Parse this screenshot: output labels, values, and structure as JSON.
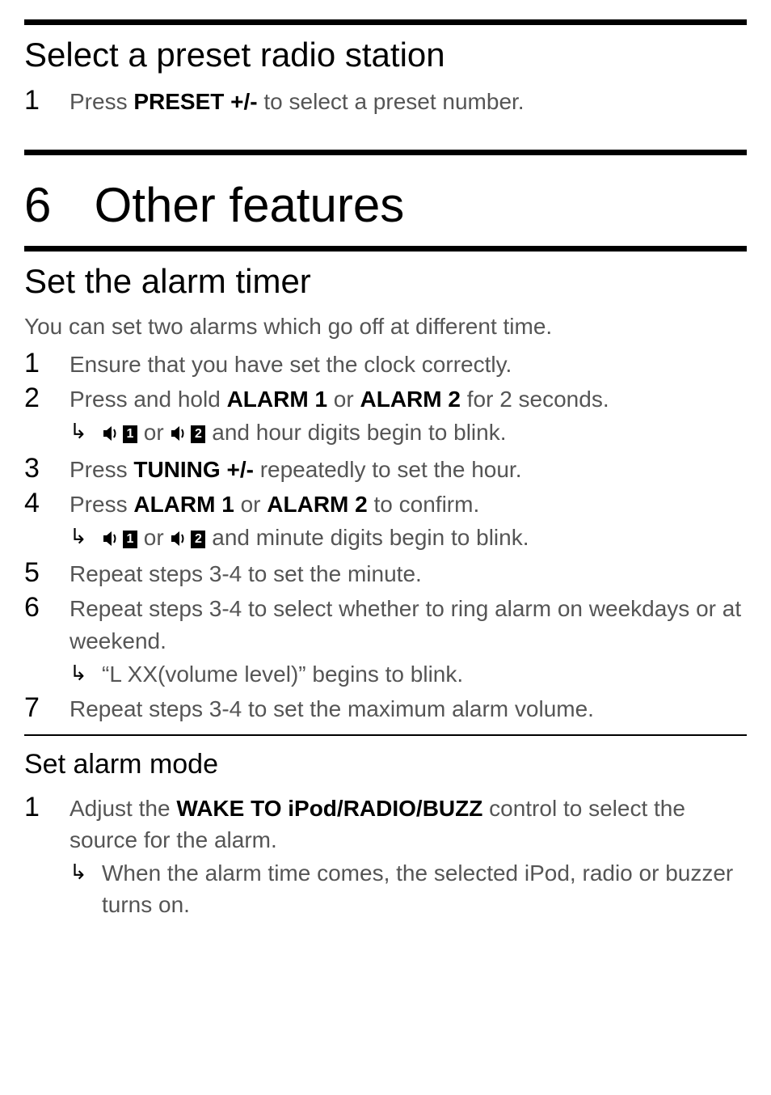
{
  "section1": {
    "heading": "Select a preset radio station",
    "step1": {
      "num": "1",
      "prefix": "Press ",
      "bold": "PRESET +/-",
      "suffix": " to select a preset number."
    }
  },
  "chapter": {
    "num": "6",
    "title": "Other features"
  },
  "section2": {
    "heading": "Set the alarm timer",
    "intro": "You can set two alarms which go off at different time.",
    "step1": {
      "num": "1",
      "text": "Ensure that you have set the clock correctly."
    },
    "step2": {
      "num": "2",
      "prefix": "Press and hold ",
      "bold1": "ALARM 1",
      "mid": " or ",
      "bold2": "ALARM 2",
      "suffix": " for 2 seconds.",
      "sub_or": " or ",
      "sub_suffix": " and hour digits begin to blink."
    },
    "step3": {
      "num": "3",
      "prefix": "Press ",
      "bold": "TUNING +/-",
      "suffix": " repeatedly to set the hour."
    },
    "step4": {
      "num": "4",
      "prefix": "Press ",
      "bold1": "ALARM 1",
      "mid": " or ",
      "bold2": "ALARM 2",
      "suffix": " to confirm.",
      "sub_or": " or ",
      "sub_suffix": " and minute digits begin to blink."
    },
    "step5": {
      "num": "5",
      "text": "Repeat steps 3-4 to set the minute."
    },
    "step6": {
      "num": "6",
      "text": "Repeat steps 3-4 to select whether to ring alarm on weekdays or at weekend.",
      "sub": "“L XX(volume level)” begins to blink."
    },
    "step7": {
      "num": "7",
      "text": "Repeat steps 3-4 to set the maximum alarm volume."
    }
  },
  "section3": {
    "heading": "Set alarm mode",
    "step1": {
      "num": "1",
      "prefix": "Adjust the ",
      "bold": "WAKE TO iPod/RADIO/BUZZ",
      "suffix": " control to select the source for the alarm.",
      "sub": "When the alarm time comes, the selected iPod, radio or buzzer turns on."
    }
  },
  "icons": {
    "alarm1_label": "1",
    "alarm2_label": "2"
  }
}
